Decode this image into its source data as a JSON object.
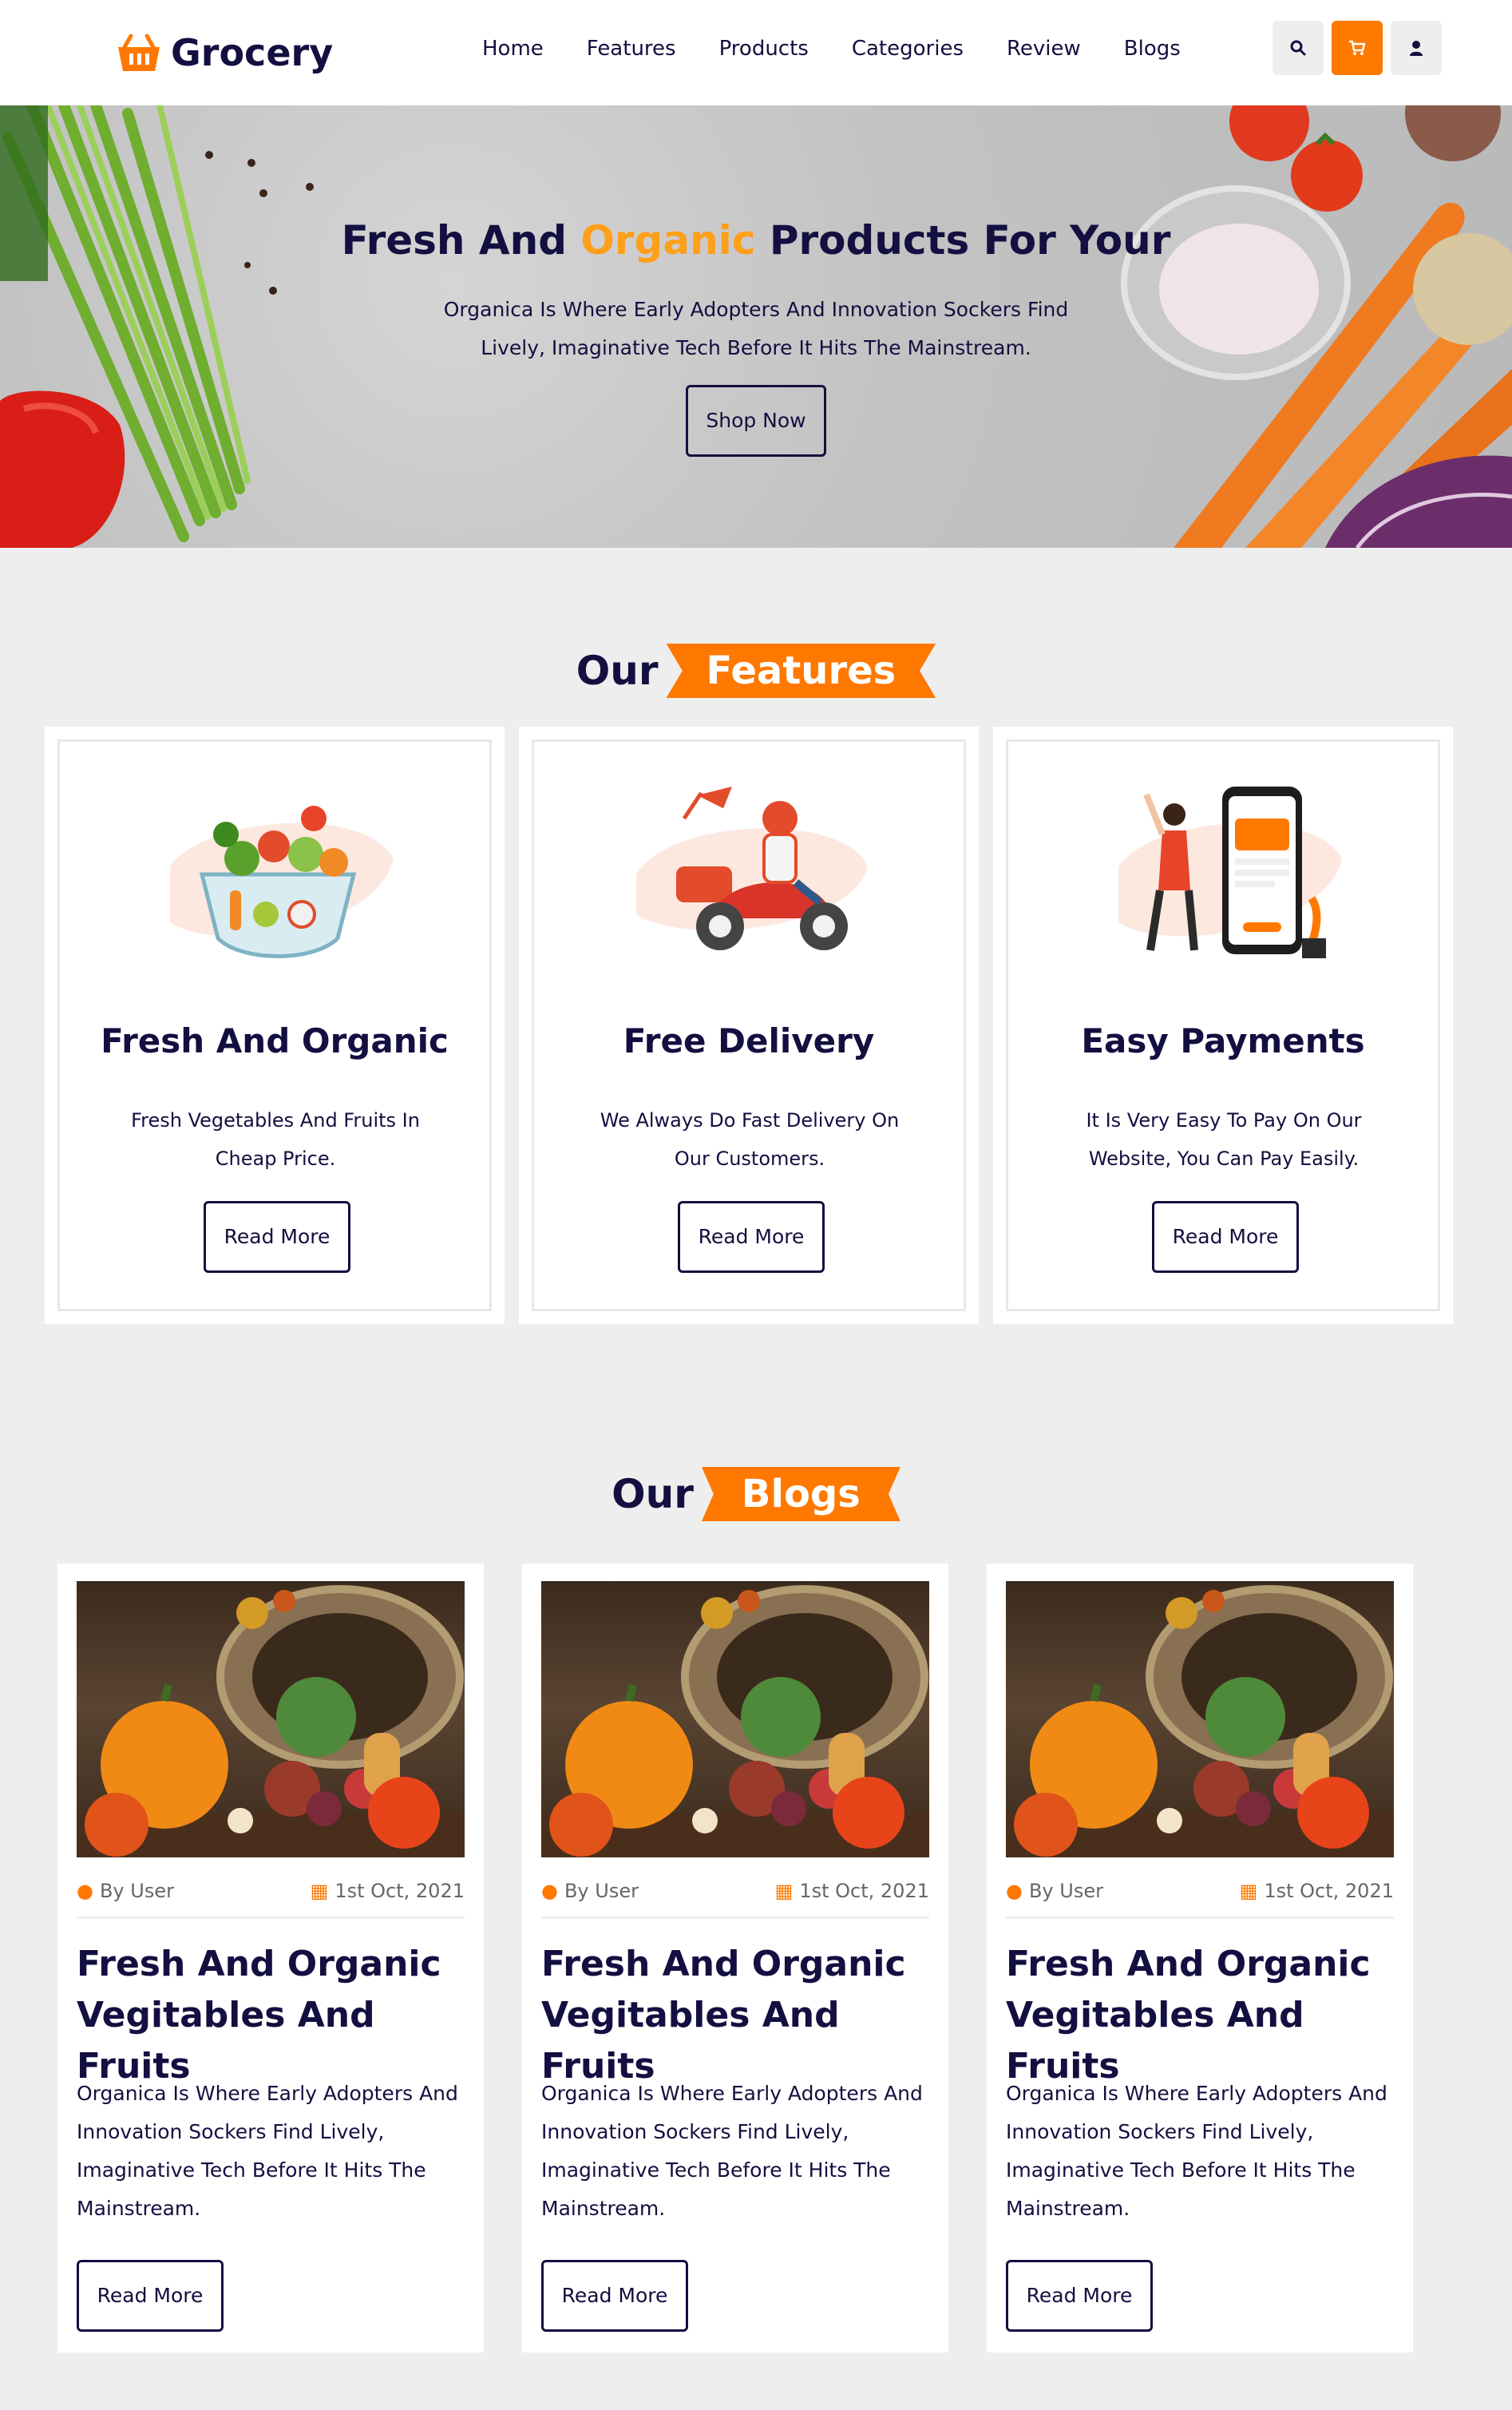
{
  "brand": {
    "name": "Grocery",
    "icon": "basket-icon",
    "accent": "#ff7800",
    "dark": "#130f40"
  },
  "nav": {
    "items": [
      "Home",
      "Features",
      "Products",
      "Categories",
      "Review",
      "Blogs"
    ]
  },
  "header_icons": [
    "search-icon",
    "cart-icon",
    "user-icon"
  ],
  "hero": {
    "title_before": "Fresh And ",
    "title_highlight": "Organic",
    "title_after": " Products For Your",
    "description": "Organica Is Where Early Adopters And Innovation Sockers Find Lively, Imaginative Tech Before It Hits The Mainstream.",
    "button": "Shop Now"
  },
  "features": {
    "heading_a": "Our",
    "heading_b": "Features",
    "cards": [
      {
        "title": "Fresh And Organic",
        "description": "Fresh Vegetables And Fruits In Cheap Price.",
        "button": "Read More",
        "image": "fresh-salad-illustration"
      },
      {
        "title": "Free Delivery",
        "description": "We Always Do Fast Delivery On Our Customers.",
        "button": "Read More",
        "image": "delivery-scooter-illustration"
      },
      {
        "title": "Easy Payments",
        "description": "It Is Very Easy To Pay On Our Website, You Can Pay Easily.",
        "button": "Read More",
        "image": "mobile-payment-illustration"
      }
    ]
  },
  "blogs": {
    "heading_a": "Our",
    "heading_b": "Blogs",
    "cards": [
      {
        "author": "By User",
        "date": "1st Oct, 2021",
        "title": "Fresh And Organic Vegitables And Fruits",
        "description": "Organica Is Where Early Adopters And Innovation Sockers Find Lively, Imaginative Tech Before It Hits The Mainstream.",
        "button": "Read More"
      },
      {
        "author": "By User",
        "date": "1st Oct, 2021",
        "title": "Fresh And Organic Vegitables And Fruits",
        "description": "Organica Is Where Early Adopters And Innovation Sockers Find Lively, Imaginative Tech Before It Hits The Mainstream.",
        "button": "Read More"
      },
      {
        "author": "By User",
        "date": "1st Oct, 2021",
        "title": "Fresh And Organic Vegitables And Fruits",
        "description": "Organica Is Where Early Adopters And Innovation Sockers Find Lively, Imaginative Tech Before It Hits The Mainstream.",
        "button": "Read More"
      }
    ]
  }
}
